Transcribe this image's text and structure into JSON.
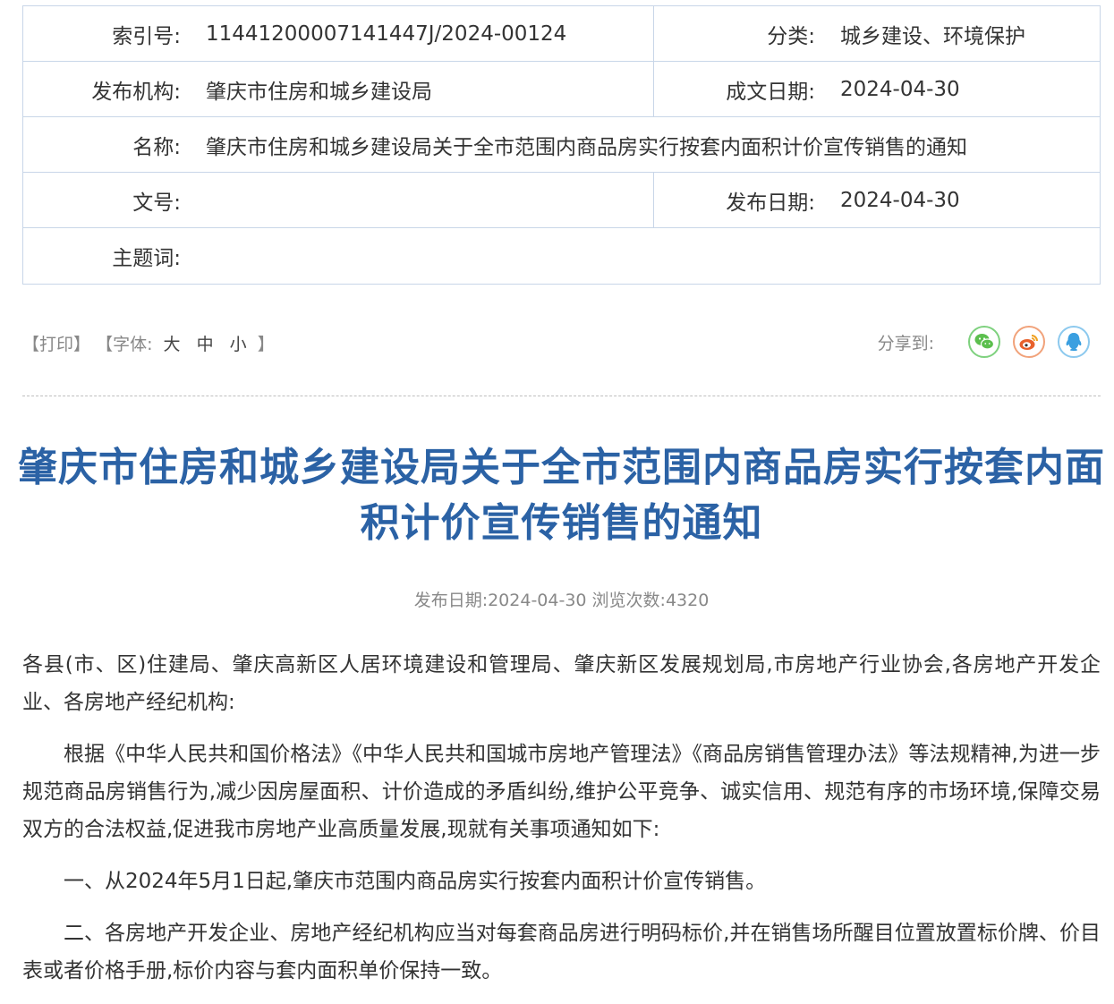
{
  "meta": {
    "index_label": "索引号:",
    "index_value": "11441200007141447J/2024-00124",
    "category_label": "分类:",
    "category_value": "城乡建设、环境保护",
    "publisher_label": "发布机构:",
    "publisher_value": "肇庆市住房和城乡建设局",
    "written_date_label": "成文日期:",
    "written_date_value": "2024-04-30",
    "name_label": "名称:",
    "name_value": "肇庆市住房和城乡建设局关于全市范围内商品房实行按套内面积计价宣传销售的通知",
    "doc_no_label": "文号:",
    "doc_no_value": "",
    "publish_date_label": "发布日期:",
    "publish_date_value": "2024-04-30",
    "keywords_label": "主题词:",
    "keywords_value": ""
  },
  "toolbar": {
    "print": "【打印】",
    "font_prefix": "【字体:",
    "font_large": "大",
    "font_medium": "中",
    "font_small": "小",
    "font_suffix": "】",
    "share_label": "分享到:",
    "share_icons": [
      "wechat-icon",
      "weibo-icon",
      "qq-icon"
    ],
    "share_colors": {
      "wechat": "#5cbf4e",
      "weibo": "#e8612c",
      "qq": "#3a9fe0"
    }
  },
  "article": {
    "title": "肇庆市住房和城乡建设局关于全市范围内商品房实行按套内面积计价宣传销售的通知",
    "pub_info": "发布日期:2024-04-30  浏览次数:4320",
    "title_color": "#2b62a5",
    "paragraphs": [
      "各县(市、区)住建局、肇庆高新区人居环境建设和管理局、肇庆新区发展规划局,市房地产行业协会,各房地产开发企业、各房地产经纪机构:",
      "根据《中华人民共和国价格法》《中华人民共和国城市房地产管理法》《商品房销售管理办法》等法规精神,为进一步规范商品房销售行为,减少因房屋面积、计价造成的矛盾纠纷,维护公平竞争、诚实信用、规范有序的市场环境,保障交易双方的合法权益,促进我市房地产业高质量发展,现就有关事项通知如下:",
      "一、从2024年5月1日起,肇庆市范围内商品房实行按套内面积计价宣传销售。",
      "二、各房地产开发企业、房地产经纪机构应当对每套商品房进行明码标价,并在销售场所醒目位置放置标价牌、价目表或者价格手册,标价内容与套内面积单价保持一致。"
    ]
  }
}
